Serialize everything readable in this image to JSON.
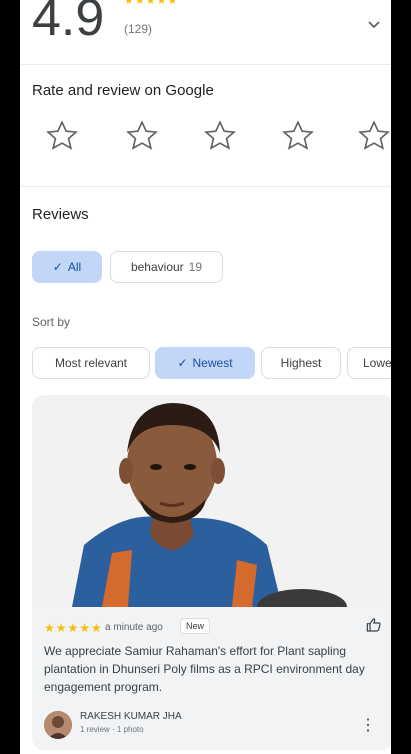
{
  "summary": {
    "rating": "4.9",
    "stars_display": "★★★★★",
    "review_count": "(129)",
    "expand_icon": "chevron-down-icon"
  },
  "rate_section": {
    "title": "Rate and review on Google",
    "star_icon": "star-outline-icon",
    "star_count": 5
  },
  "reviews": {
    "title": "Reviews",
    "filters": [
      {
        "label": "All",
        "selected": true
      },
      {
        "label": "behaviour",
        "count": "19",
        "selected": false
      }
    ],
    "sort_label": "Sort by",
    "sort_options": [
      {
        "label": "Most relevant",
        "selected": false
      },
      {
        "label": "Newest",
        "selected": true
      },
      {
        "label": "Highest",
        "selected": false
      },
      {
        "label": "Lowest",
        "selected": false
      }
    ]
  },
  "review_card": {
    "stars": "★★★★★",
    "time": "a minute ago",
    "badge": "New",
    "text": "We appreciate Samiur Rahaman's effort for Plant sapling plantation in Dhunseri Poly films as a RPCI environment day engagement program.",
    "author": "RAKESH KUMAR JHA",
    "author_meta": "1 review · 1 photo",
    "like_icon": "thumbs-up-icon",
    "more_icon": "more-vert-icon"
  },
  "colors": {
    "selected_chip_bg": "#c2d7f7",
    "star_gold": "#fbbc04",
    "card_bg": "#f1f3f4"
  }
}
